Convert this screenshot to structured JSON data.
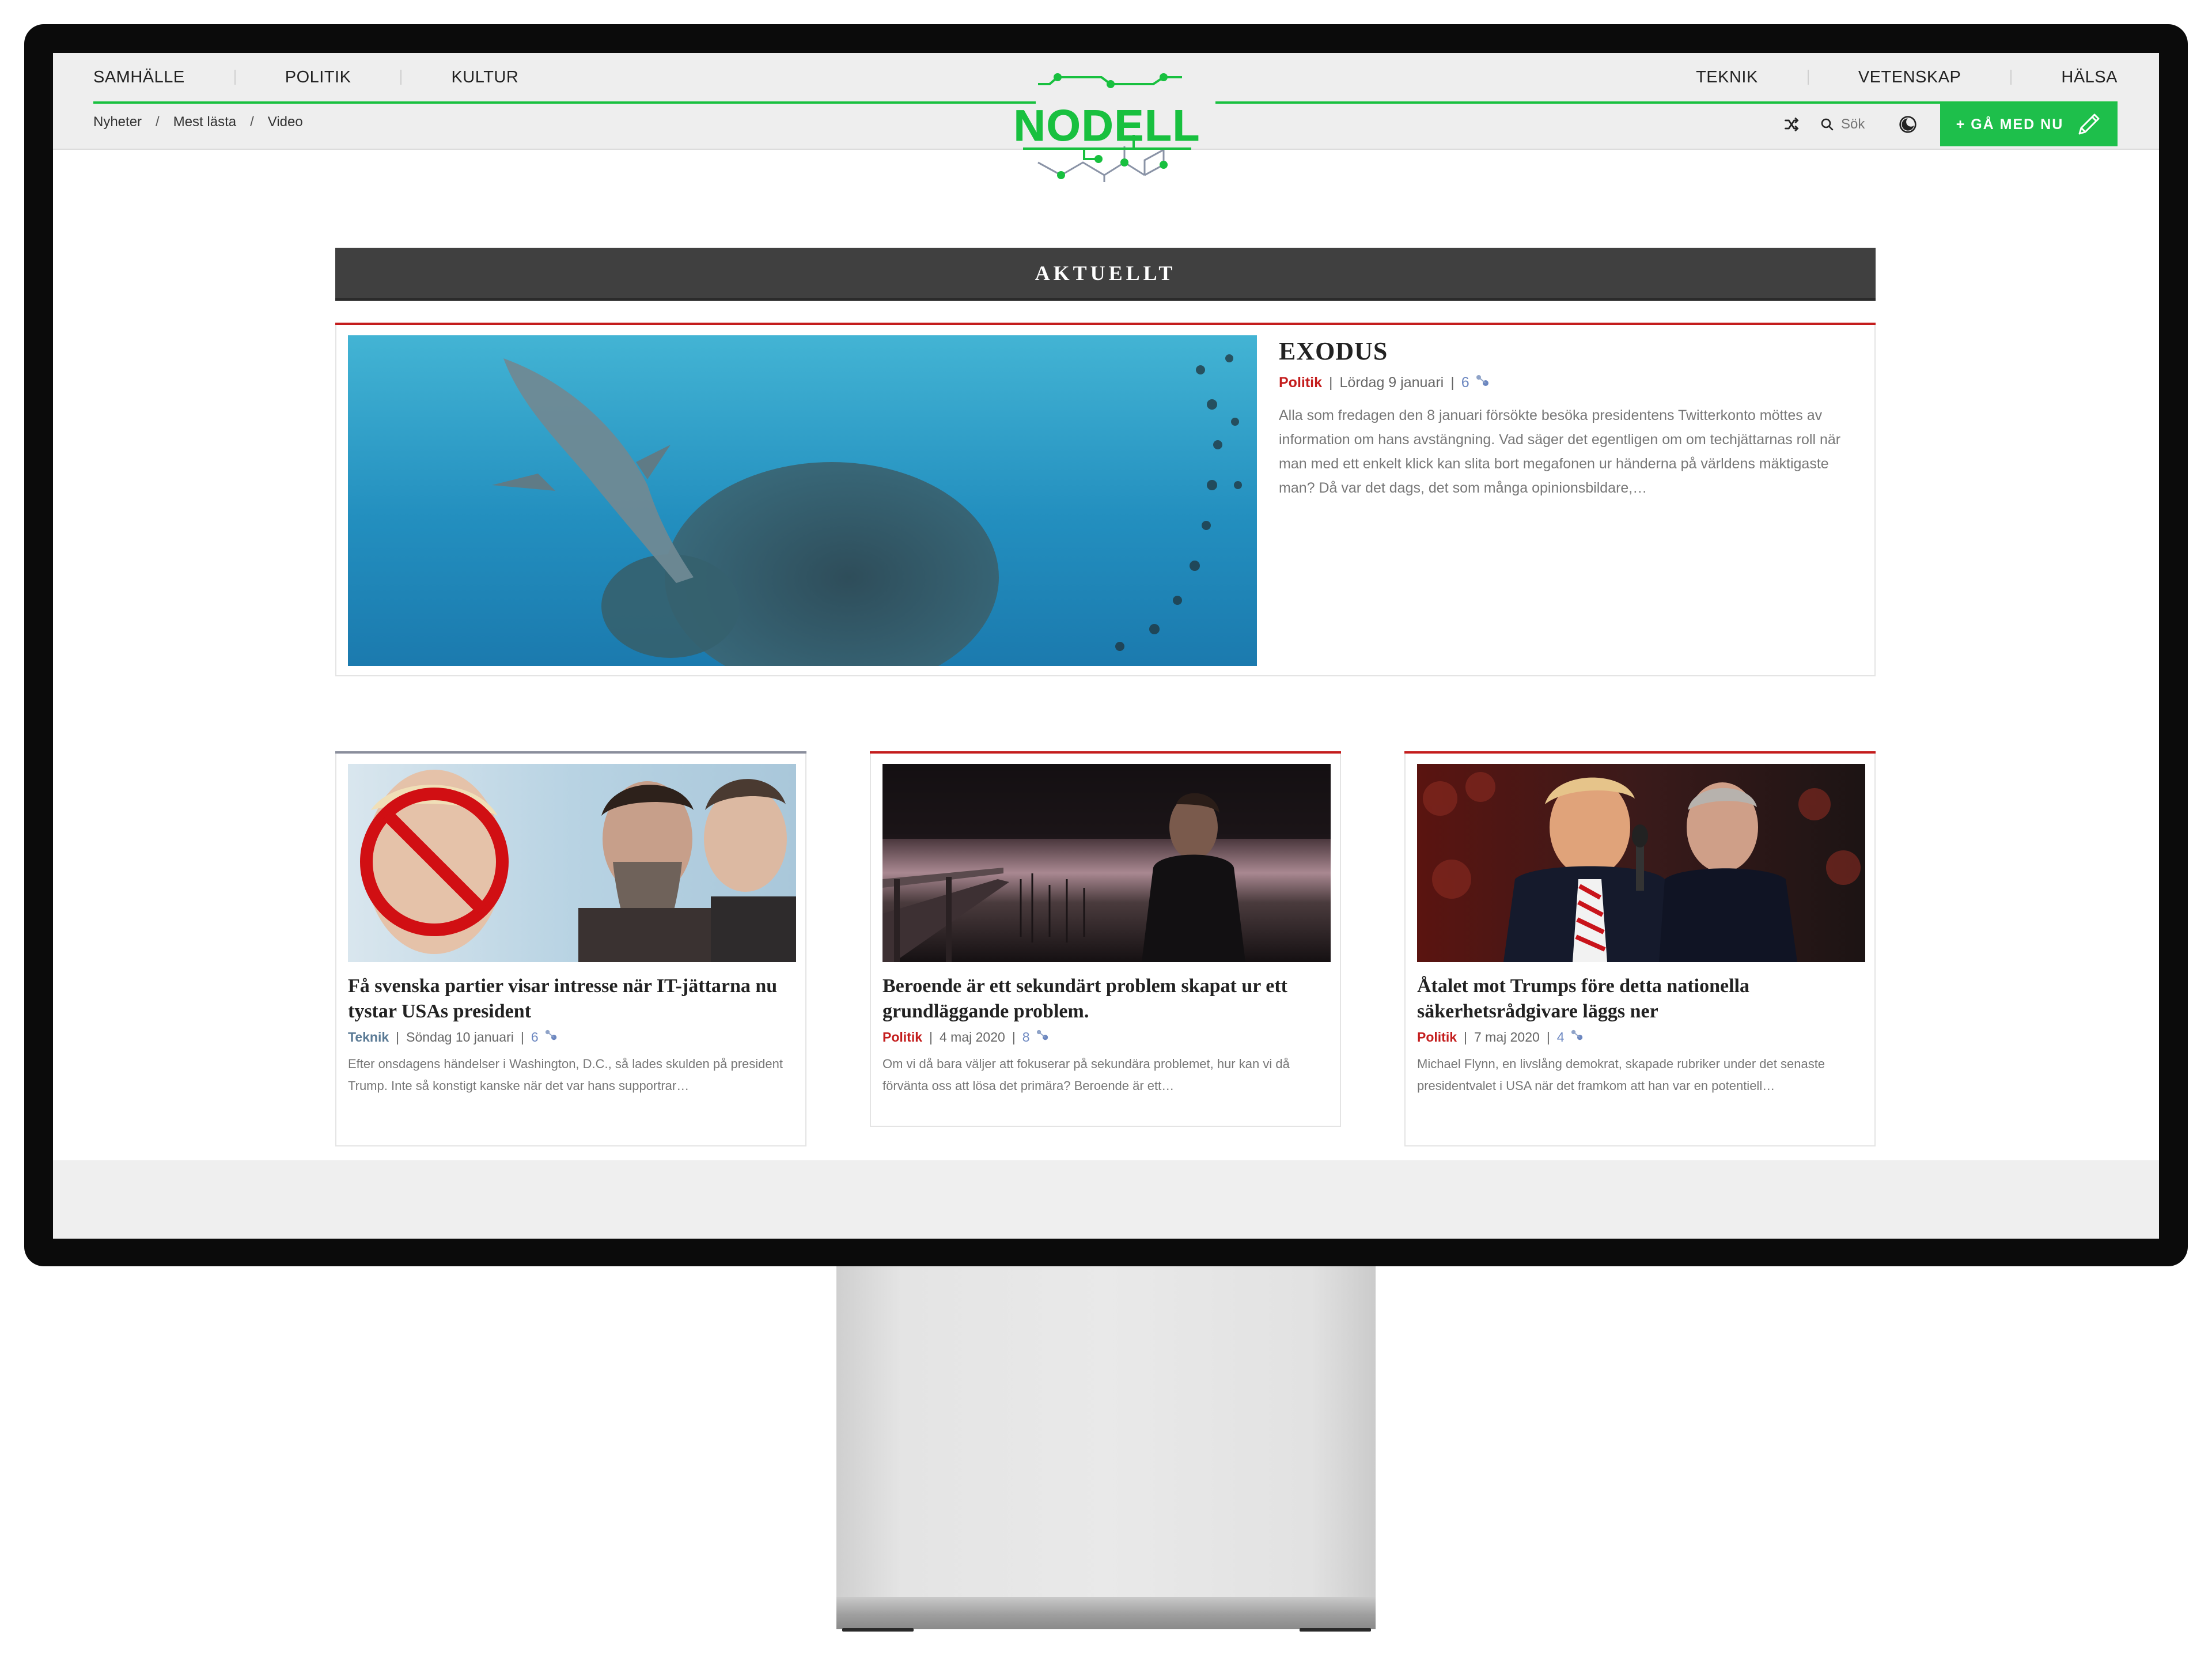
{
  "nav": {
    "left": [
      "SAMHÄLLE",
      "POLITIK",
      "KULTUR"
    ],
    "right": [
      "TEKNIK",
      "VETENSKAP",
      "HÄLSA"
    ]
  },
  "breadcrumb": [
    "Nyheter",
    "Mest lästa",
    "Video"
  ],
  "logo_text": "NODELL",
  "tools": {
    "search_placeholder": "Sök",
    "join_label": "+ GÅ MED NU"
  },
  "section_title": "AKTUELLT",
  "featured": {
    "title": "EXODUS",
    "category": "Politik",
    "date": "Lördag 9 januari",
    "comments": "6",
    "excerpt": "Alla som fredagen den 8 januari försökte besöka presidentens Twitterkonto möttes av information om hans avstängning. Vad säger det egentligen om om techjättarnas roll när man med ett enkelt klick kan slita bort megafonen ur händerna på världens mäktigaste man? Då var det dags, det som många opinionsbildare,…"
  },
  "articles": [
    {
      "title": "Få svenska partier visar intresse när IT-jättarna nu tystar USAs president",
      "category": "Teknik",
      "date": "Söndag 10 januari",
      "comments": "6",
      "excerpt": "Efter onsdagens händelser i Washington, D.C., så lades skulden på president Trump. Inte så konstigt kanske när det var hans supportrar…"
    },
    {
      "title": "Beroende är ett sekundärt problem skapat ur ett grundläggande problem.",
      "category": "Politik",
      "date": "4 maj 2020",
      "comments": "8",
      "excerpt": "Om vi då bara väljer att fokuserar på sekundära problemet, hur kan vi då förvänta oss att lösa det primära? Beroende är ett…"
    },
    {
      "title": "Åtalet mot Trumps före detta nationella säkerhetsrådgivare läggs ner",
      "category": "Politik",
      "date": "7 maj 2020",
      "comments": "4",
      "excerpt": "Michael Flynn, en livslång demokrat, skapade rubriker under det senaste presidentvalet i USA när det framkom att han var en potentiell…"
    }
  ],
  "colors": {
    "brand_green": "#1ebf4b",
    "accent_red": "#c41d1d",
    "teknik_blue": "#5a7a95",
    "section_bar": "#404040"
  }
}
